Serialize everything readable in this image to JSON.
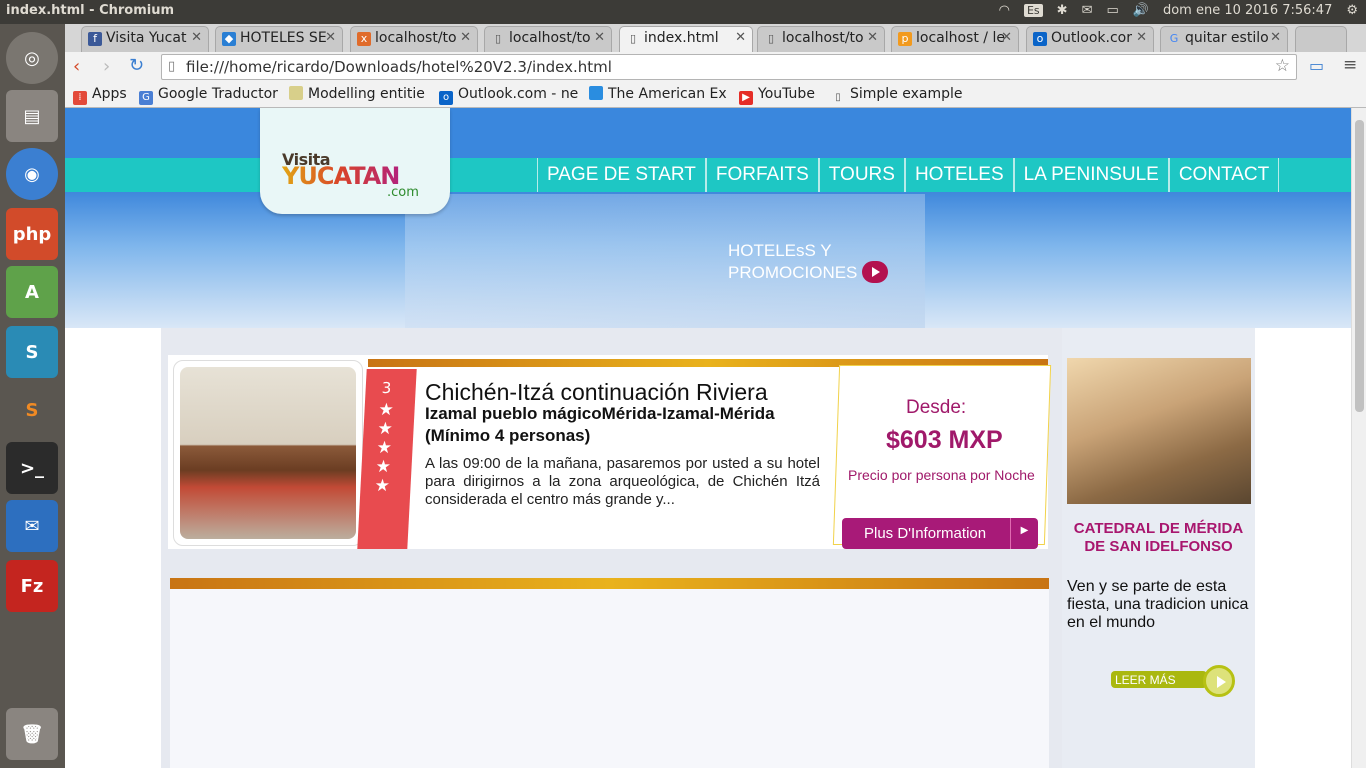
{
  "window": {
    "title": "index.html - Chromium"
  },
  "topbar": {
    "keyboard": "Es",
    "datetime": "dom ene 10 2016  7:56:47"
  },
  "tabs": [
    {
      "label": "Visita Yucat",
      "icon": "facebook-icon"
    },
    {
      "label": "HOTELES SE",
      "icon": "dropbox-icon"
    },
    {
      "label": "localhost/to",
      "icon": "xampp-icon"
    },
    {
      "label": "localhost/to",
      "icon": "page-icon"
    },
    {
      "label": "index.html",
      "icon": "page-icon",
      "active": true
    },
    {
      "label": "localhost/to",
      "icon": "page-icon"
    },
    {
      "label": "localhost / le",
      "icon": "phpmyadmin-icon"
    },
    {
      "label": "Outlook.cor",
      "icon": "outlook-icon"
    },
    {
      "label": "quitar estilo",
      "icon": "google-icon"
    }
  ],
  "address": {
    "url": "file:///home/ricardo/Downloads/hotel%20V2.3/index.html"
  },
  "bookmarks": [
    {
      "label": "Apps"
    },
    {
      "label": "Google Traductor"
    },
    {
      "label": "Modelling entitie"
    },
    {
      "label": "Outlook.com - ne"
    },
    {
      "label": "The American Ex"
    },
    {
      "label": "YouTube"
    },
    {
      "label": "Simple example"
    }
  ],
  "site": {
    "logo": {
      "line1": "Visita",
      "line2": "YUCATAN",
      "line3": ".com"
    },
    "menu": [
      "PAGE DE START",
      "FORFAITS",
      "TOURS",
      "HOTELES",
      "LA PENINSULE",
      "CONTACT"
    ],
    "promo": {
      "line1": "HOTELEsS Y",
      "line2": "PROMOCIONES"
    },
    "card": {
      "stars": "3",
      "title": "Chichén-Itzá continuación Riviera",
      "subtitle": "Izamal pueblo mágicoMérida-Izamal-Mérida (Mínimo 4 personas)",
      "description": "A las 09:00 de la mañana, pasaremos por usted a su hotel para dirigirnos a la zona arqueológica, de Chichén Itzá considerada el centro más grande y...",
      "from_label": "Desde:",
      "price": "$603 MXP",
      "per_label": "Precio por persona por Noche",
      "button": "Plus D'Information"
    },
    "sidebar": {
      "title": "CATEDRAL DE MÉRIDA DE SAN IDELFONSO",
      "text": "Ven y se parte de esta fiesta, una tradicion unica en el mundo",
      "button": "LEER MÁS"
    }
  },
  "colors": {
    "sky": "#3a87dd",
    "nav": "#1ec7c4",
    "magenta": "#a0196a",
    "ribbon": "#e84b4f",
    "gold": "#e9b21c",
    "leer": "#aab80f"
  }
}
